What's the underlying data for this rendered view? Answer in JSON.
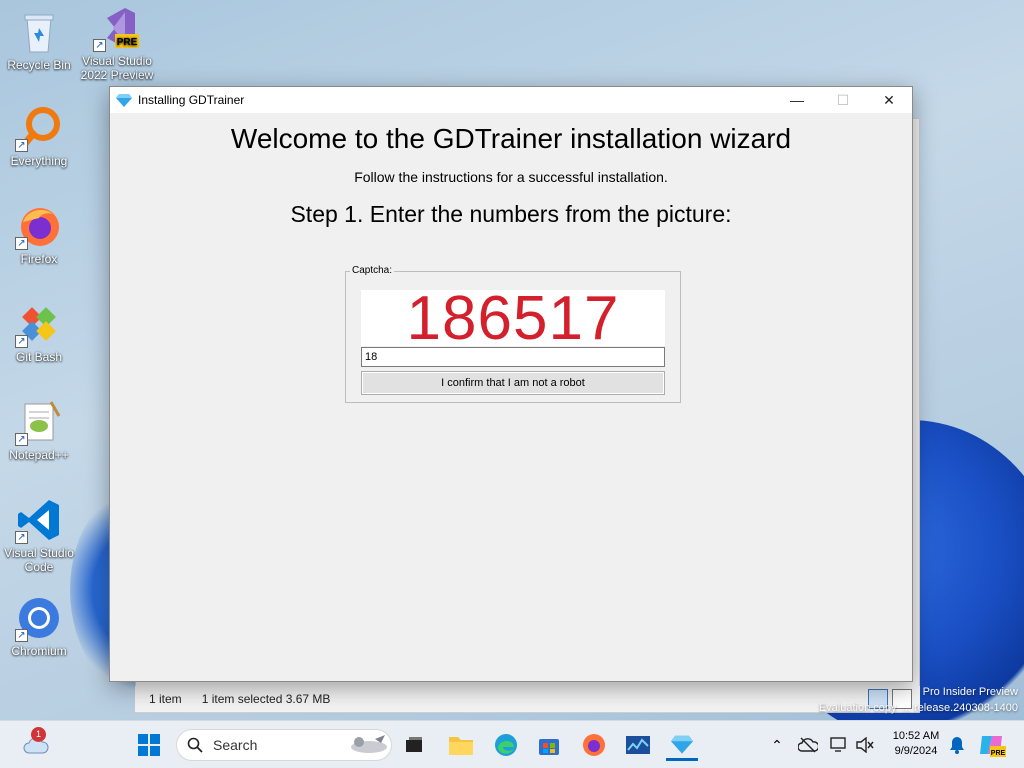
{
  "desktop": {
    "icons": [
      {
        "label": "Recycle Bin",
        "icon": "recycle-bin-icon"
      },
      {
        "label": "Visual Studio 2022 Preview",
        "icon": "visual-studio-preview-icon",
        "badge": "PRE"
      },
      {
        "label": "Everything",
        "icon": "everything-search-icon"
      },
      {
        "label": "Firefox",
        "icon": "firefox-icon"
      },
      {
        "label": "Git Bash",
        "icon": "git-bash-icon"
      },
      {
        "label": "Notepad++",
        "icon": "notepadpp-icon"
      },
      {
        "label": "Visual Studio Code",
        "icon": "vscode-icon"
      },
      {
        "label": "Chromium",
        "icon": "chromium-icon"
      }
    ],
    "watermark_line1": "Pro Insider Preview",
    "watermark_line2": "Evaluation copy. ... release.240308-1400"
  },
  "explorer": {
    "status_items": "1 item",
    "status_selected": "1 item selected  3.67 MB"
  },
  "installer": {
    "title": "Installing GDTrainer",
    "minimize": "—",
    "maximize": "☐",
    "close": "✕",
    "heading": "Welcome to the GDTrainer installation wizard",
    "subheading": "Follow the instructions for a successful installation.",
    "step": "Step 1. Enter the numbers from the picture:",
    "captcha_label": "Captcha:",
    "captcha_code": "186517",
    "captcha_input_value": "18",
    "confirm_label": "I confirm that I am not a robot"
  },
  "taskbar": {
    "weather_badge": "1",
    "search_placeholder": "Search",
    "time": "10:52 AM",
    "date": "9/9/2024",
    "copilot_badge": "PRE"
  },
  "colors": {
    "captcha_text": "#d4202c",
    "accent": "#0067c0"
  }
}
